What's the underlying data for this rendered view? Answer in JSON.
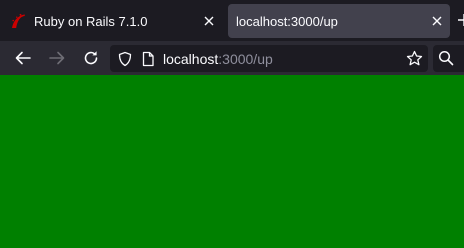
{
  "tabs": [
    {
      "label": "Ruby on Rails 7.1.0",
      "favicon": "rails-icon",
      "active": false
    },
    {
      "label": "localhost:3000/up",
      "favicon": null,
      "active": true
    }
  ],
  "newtab_icon": "plus-icon",
  "nav": {
    "back_icon": "back-arrow-icon",
    "forward_icon": "forward-arrow-icon",
    "reload_icon": "reload-icon"
  },
  "urlbar": {
    "host": "localhost",
    "rest": ":3000/up",
    "security_icon": "shield-icon",
    "page_icon": "page-icon",
    "bookmark_icon": "star-icon"
  },
  "search_icon": "search-icon",
  "content": {
    "background": "#008000"
  },
  "colors": {
    "tabbar": "#1c1b22",
    "active_tab": "#42414d",
    "toolbar": "#2b2a33",
    "rails_red": "#cc0000"
  }
}
